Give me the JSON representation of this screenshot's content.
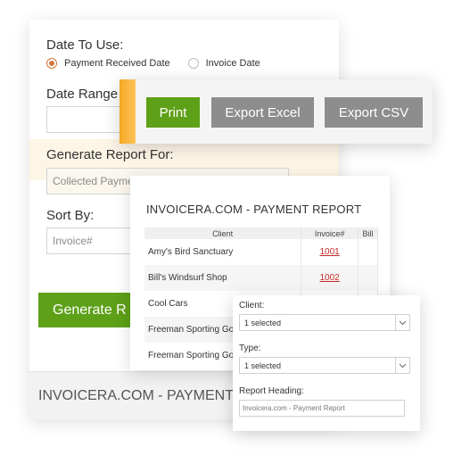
{
  "form": {
    "date_to_use_label": "Date To Use:",
    "radio_payment_received": "Payment Received Date",
    "radio_invoice_date": "Invoice Date",
    "date_range_label": "Date Range",
    "generate_for_label": "Generate Report For:",
    "generate_for_value": "Collected Payme",
    "sort_by_label": "Sort By:",
    "sort_by_value": "Invoice#",
    "generate_button": "Generate R",
    "footer_title": "INVOICERA.COM - PAYMENT"
  },
  "toolbar": {
    "print": "Print",
    "export_excel": "Export Excel",
    "export_csv": "Export CSV",
    "accent_color": "#f5a623"
  },
  "report": {
    "title": "INVOICERA.COM - PAYMENT REPORT",
    "columns": [
      "Client",
      "Invoice#",
      "Bill"
    ],
    "rows": [
      {
        "client": "Amy's Bird Sanctuary",
        "invoice": "1001"
      },
      {
        "client": "Bill's Windsurf Shop",
        "invoice": "1002"
      },
      {
        "client": "Cool Cars",
        "invoice": ""
      },
      {
        "client": "Freeman Sporting Goo",
        "invoice": ""
      },
      {
        "client": "Freeman Sporting Goo",
        "invoice": ""
      }
    ]
  },
  "filters": {
    "client_label": "Client:",
    "client_value": "1 selected",
    "type_label": "Type:",
    "type_value": "1 selected",
    "heading_label": "Report Heading:",
    "heading_value": "Invoicera.com - Payment Report"
  },
  "colors": {
    "primary_green": "#5ea018",
    "gray_button": "#8d8d8d",
    "invoice_link": "#c72a2a",
    "radio_accent": "#d3753a"
  }
}
